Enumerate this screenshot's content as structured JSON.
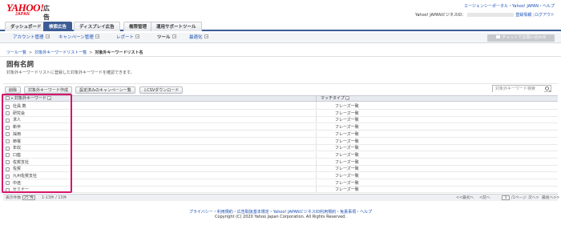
{
  "header": {
    "logo_yahoo": "YAHOO!",
    "logo_japan": "JAPAN",
    "logo_ad": "広告",
    "top_links": "エージェンシーポータル・Yahoo! JAPAN・ヘルプ",
    "account_label": "Yahoo! JAPANビジネスID：",
    "registered_info": "登録情報",
    "logout": "ログアウト"
  },
  "main_tabs": [
    {
      "label": "ダッシュボード"
    },
    {
      "label": "検索広告"
    },
    {
      "label": "ディスプレイ広告"
    },
    {
      "label": "権限管理"
    },
    {
      "label": "運用サポートツール"
    }
  ],
  "sub_tabs": [
    {
      "label": "アカウント管理"
    },
    {
      "label": "キャンペーン管理"
    },
    {
      "label": "レポート"
    },
    {
      "label": "ツール"
    },
    {
      "label": "最適化"
    }
  ],
  "support_button": "チャットでお問い合わせ",
  "breadcrumb": {
    "items": [
      "ツール一覧",
      "対象外キーワードリスト一覧"
    ],
    "current": "対象外キーワードリスト名"
  },
  "page": {
    "title": "固有名詞",
    "description": "対象外キーワードリストに登録した対象外キーワードを確認できます。"
  },
  "toolbar": {
    "delete": "削除",
    "create": "対象外キーワード作成",
    "campaigns": "設定済みのキャンペーン一覧",
    "csv": "CSVダウンロード",
    "csv_prefix": "⇩",
    "search_placeholder": "対象外キーワード検索"
  },
  "table": {
    "headers": {
      "keyword": "対象外キーワード",
      "match_type": "マッチタイプ"
    },
    "rows": [
      {
        "keyword": "社員 数",
        "match_type": "フレーズ一致"
      },
      {
        "keyword": "研究会",
        "match_type": "フレーズ一致"
      },
      {
        "keyword": "求人",
        "match_type": "フレーズ一致"
      },
      {
        "keyword": "新卒",
        "match_type": "フレーズ一致"
      },
      {
        "keyword": "採用",
        "match_type": "フレーズ一致"
      },
      {
        "keyword": "節電",
        "match_type": "フレーズ一致"
      },
      {
        "keyword": "年収",
        "match_type": "フレーズ一致"
      },
      {
        "keyword": "口座",
        "match_type": "フレーズ一致"
      },
      {
        "keyword": "佐賀支社",
        "match_type": "フレーズ一致"
      },
      {
        "keyword": "佐賀",
        "match_type": "フレーズ一致"
      },
      {
        "keyword": "九州佐賀支社",
        "match_type": "フレーズ一致"
      },
      {
        "keyword": "中途",
        "match_type": "フレーズ一致"
      },
      {
        "keyword": "セミナー",
        "match_type": "フレーズ一致"
      }
    ]
  },
  "pagination": {
    "display_label": "表示件数",
    "per_page": "25 件",
    "range": "1-13件 / 13件",
    "first": "<<最初へ",
    "prev": "<前へ",
    "page": "1",
    "page_info": "/1ページ",
    "next": "次へ>",
    "last": "最後へ>>"
  },
  "footer": {
    "links": "プライバシー・利用規約・広告取扱基本規定・Yahoo! JAPANビジネスID利用規約・免責事項・ヘルプ",
    "copyright": "Copyright (C) 2020 Yahoo Japan Corporation. All Rights Reserved."
  },
  "colors": {
    "brand_red": "#e60012",
    "nav_blue": "#3c5c96",
    "link_blue": "#1a4fb5",
    "highlight_pink": "#d6156c"
  }
}
